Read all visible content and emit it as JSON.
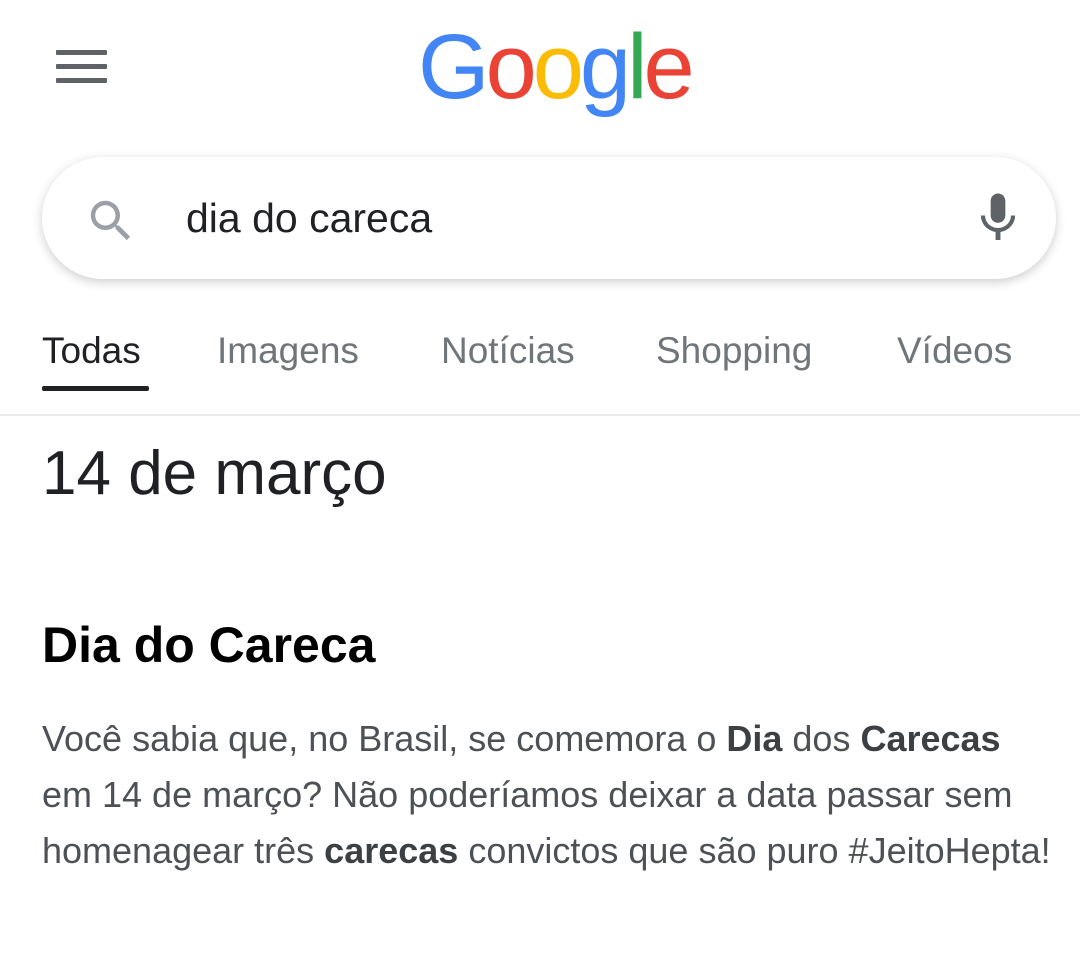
{
  "header": {
    "logo": {
      "letters": [
        "G",
        "o",
        "o",
        "g",
        "l",
        "e"
      ],
      "colors": [
        "#4285F4",
        "#EA4335",
        "#FBBC05",
        "#4285F4",
        "#34A853",
        "#EA4335"
      ]
    },
    "menu_icon": "hamburger-menu-icon"
  },
  "search": {
    "query": "dia do careca",
    "search_icon": "search-icon",
    "mic_icon": "mic-icon"
  },
  "tabs": [
    {
      "label": "Todas",
      "active": true
    },
    {
      "label": "Imagens",
      "active": false
    },
    {
      "label": "Notícias",
      "active": false
    },
    {
      "label": "Shopping",
      "active": false
    },
    {
      "label": "Vídeos",
      "active": false
    }
  ],
  "featured_answer": "14 de março",
  "result": {
    "title": "Dia do Careca",
    "snippet": {
      "part1": "Você sabia que, no Brasil, se comemora o ",
      "bold1": "Dia",
      "part2": " dos ",
      "bold2": "Carecas",
      "part3": " em 14 de março? Não poderíamos deixar a data passar sem homenagear três ",
      "bold3": "carecas",
      "part4": " convictos que são puro #JeitoHepta!"
    }
  },
  "colors": {
    "text_primary": "#202124",
    "text_secondary": "#70757a",
    "icon_gray": "#5f6368"
  }
}
